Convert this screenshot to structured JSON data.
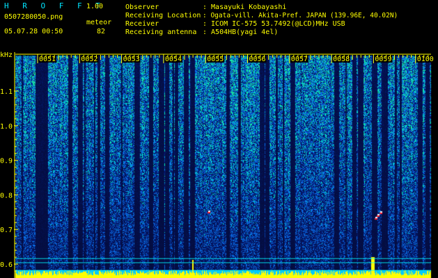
{
  "header": {
    "app_name": "H R O F F T",
    "version": "1.00",
    "filename": "0507280050.png",
    "datetime": "05.07.28 00:50",
    "count_label": "meteor",
    "count_value": "82"
  },
  "info": [
    {
      "label": "Observer",
      "value": ": Masayuki Kobayashi"
    },
    {
      "label": "Receiving Location",
      "value": ": Ogata-vill. Akita-Pref. JAPAN (139.96E, 40.02N)"
    },
    {
      "label": "Receiver",
      "value": ": ICOM IC-575 53.7492(@LCD)MHz USB"
    },
    {
      "label": "Receiving antenna",
      "value": ": A504HB(yagi 4el)"
    }
  ],
  "chart_data": {
    "type": "heatmap",
    "y_unit_label": "kHz",
    "y_ticks": [
      "1.1",
      "1.0",
      "0.9",
      "0.8",
      "0.7",
      "0.6"
    ],
    "x_ticks": [
      "0051",
      "0052",
      "0053",
      "0054",
      "0055",
      "0056",
      "0057",
      "0058",
      "0059",
      "0100"
    ],
    "colors": {
      "background": "#000000",
      "low": "#0a1e8c",
      "mid": "#1464ff",
      "high": "#00ffb4",
      "peak": "#ff2030",
      "label": "#ffff00",
      "grid": "#00ffff"
    }
  }
}
